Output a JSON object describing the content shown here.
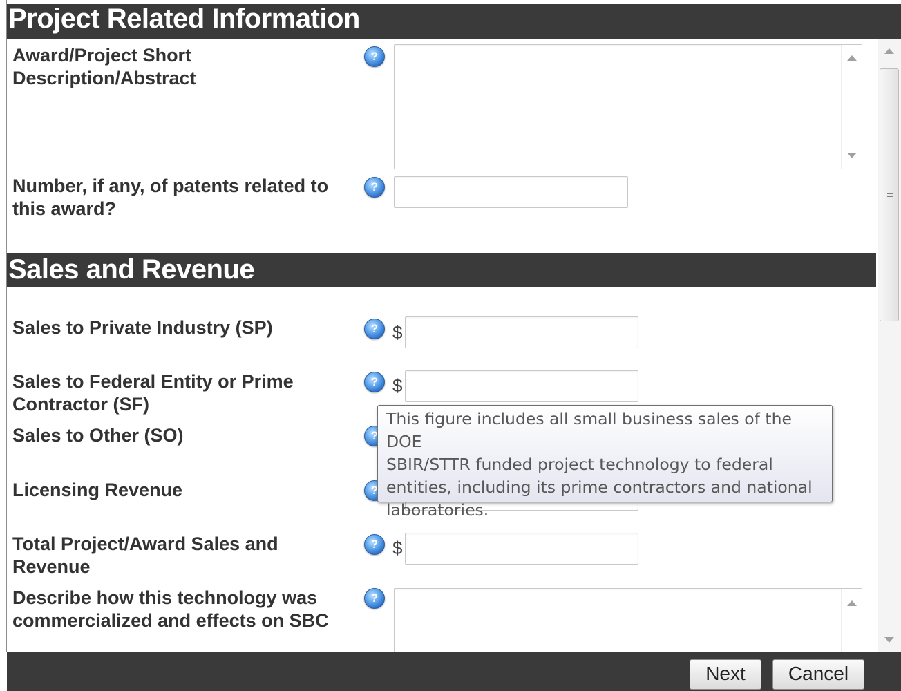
{
  "sections": {
    "project": {
      "title": "Project Related Information"
    },
    "sales": {
      "title": "Sales and Revenue"
    }
  },
  "fields": {
    "abstract": {
      "label_line1": "Award/Project Short",
      "label_line2": "Description/Abstract",
      "value": ""
    },
    "patents": {
      "label_line1": "Number, if any, of patents related to",
      "label_line2": "this award?",
      "value": ""
    },
    "sp": {
      "label": "Sales to Private Industry (SP)",
      "currency": "$",
      "value": ""
    },
    "sf": {
      "label_line1": "Sales to Federal Entity or Prime",
      "label_line2": "Contractor (SF)",
      "currency": "$",
      "value": ""
    },
    "so": {
      "label": "Sales to Other (SO)"
    },
    "licensing": {
      "label": "Licensing Revenue"
    },
    "total": {
      "label_line1": "Total Project/Award Sales and",
      "label_line2": "Revenue",
      "currency": "$",
      "value": ""
    },
    "commercialized": {
      "label_line1": "Describe how this technology was",
      "label_line2": "commercialized and effects on SBC"
    }
  },
  "help_icon": {
    "icon": "help-question-icon",
    "glyph": "?"
  },
  "tooltip": {
    "line1": "This figure includes all small business sales of the DOE",
    "line2": "SBIR/STTR funded project technology to federal",
    "line3": "entities, including its prime contractors and national",
    "line4": "laboratories."
  },
  "footer": {
    "next_label": "Next",
    "cancel_label": "Cancel"
  },
  "colors": {
    "section_bar": "#3a3a3a",
    "help_icon": "#2a6fc9"
  }
}
